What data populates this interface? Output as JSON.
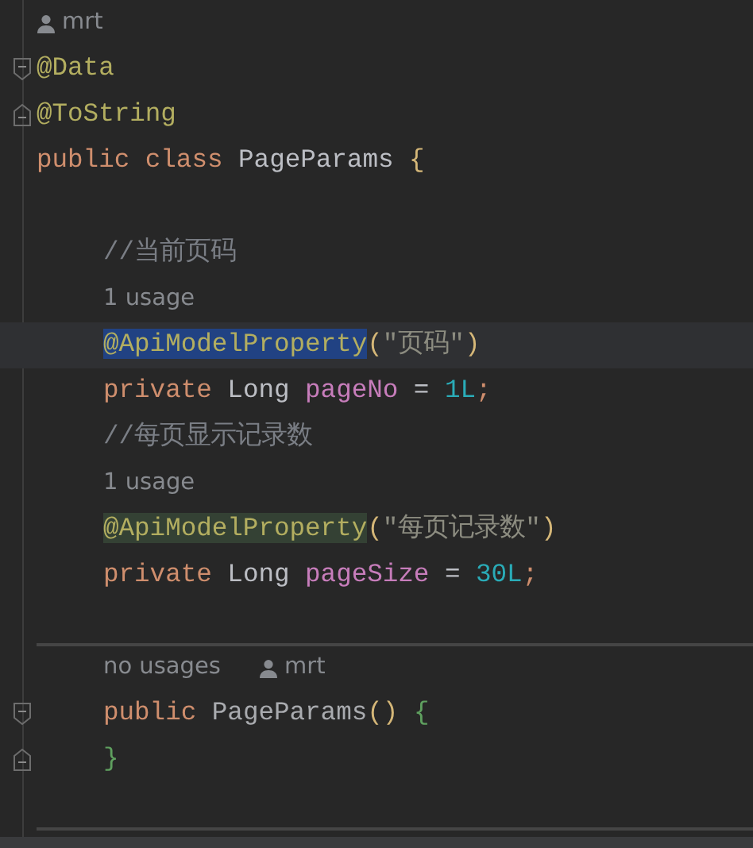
{
  "blocks": [
    {
      "indented": false,
      "lines": [
        {
          "kind": "hint",
          "author": "mrt"
        },
        {
          "kind": "code",
          "fold_start": true,
          "tokens": [
            {
              "text": "@Data",
              "kind": "annotation"
            }
          ]
        },
        {
          "kind": "code",
          "fold_end": true,
          "tokens": [
            {
              "text": "@ToString",
              "kind": "annotation"
            }
          ]
        },
        {
          "kind": "code",
          "tokens": [
            {
              "text": "public",
              "kind": "keyword"
            },
            {
              "text": " class ",
              "kind": "keyword"
            },
            {
              "text": "PageParams ",
              "kind": "plain"
            },
            {
              "text": "{",
              "kind": "paren"
            }
          ]
        },
        {
          "kind": "blank"
        }
      ]
    },
    {
      "indented": true,
      "lines": [
        {
          "kind": "code",
          "tokens": [
            {
              "text": "//当前页码",
              "kind": "comment"
            }
          ]
        },
        {
          "kind": "hint",
          "usages": "1 usage"
        },
        {
          "kind": "code",
          "current": true,
          "tokens": [
            {
              "text": "@ApiModelProperty",
              "kind": "annotation",
              "selected": true
            },
            {
              "text": "(",
              "kind": "paren"
            },
            {
              "text": "\"页码\"",
              "kind": "string"
            },
            {
              "text": ")",
              "kind": "paren"
            }
          ]
        },
        {
          "kind": "code",
          "tokens": [
            {
              "text": "private ",
              "kind": "keyword"
            },
            {
              "text": "Long ",
              "kind": "plain"
            },
            {
              "text": "pageNo",
              "kind": "field"
            },
            {
              "text": " = ",
              "kind": "plain"
            },
            {
              "text": "1L",
              "kind": "number"
            },
            {
              "text": ";",
              "kind": "keyword"
            }
          ]
        },
        {
          "kind": "code",
          "tokens": [
            {
              "text": "//每页显示记录数",
              "kind": "comment"
            }
          ]
        },
        {
          "kind": "hint",
          "usages": "1 usage"
        },
        {
          "kind": "code",
          "tokens": [
            {
              "text": "@ApiModelProperty",
              "kind": "annotation",
              "highlighted": true
            },
            {
              "text": "(",
              "kind": "paren"
            },
            {
              "text": "\"每页记录数\"",
              "kind": "string"
            },
            {
              "text": ")",
              "kind": "paren"
            }
          ]
        },
        {
          "kind": "code",
          "tokens": [
            {
              "text": "private ",
              "kind": "keyword"
            },
            {
              "text": "Long ",
              "kind": "plain"
            },
            {
              "text": "pageSize",
              "kind": "field"
            },
            {
              "text": " = ",
              "kind": "plain"
            },
            {
              "text": "30L",
              "kind": "number"
            },
            {
              "text": ";",
              "kind": "keyword"
            }
          ]
        },
        {
          "kind": "blank"
        },
        {
          "kind": "separator"
        },
        {
          "kind": "hint",
          "usages": "no usages",
          "author": "mrt"
        },
        {
          "kind": "code",
          "fold_start": true,
          "tokens": [
            {
              "text": "public ",
              "kind": "keyword"
            },
            {
              "text": "PageParams",
              "kind": "method"
            },
            {
              "text": "()",
              "kind": "paren"
            },
            {
              "text": " {",
              "kind": "brace"
            }
          ]
        },
        {
          "kind": "code",
          "fold_end": true,
          "tokens": [
            {
              "text": "}",
              "kind": "brace"
            }
          ]
        },
        {
          "kind": "blank"
        },
        {
          "kind": "separator"
        }
      ]
    }
  ]
}
